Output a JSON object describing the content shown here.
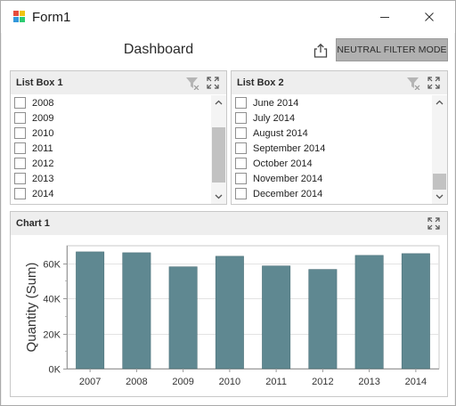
{
  "window": {
    "title": "Form1"
  },
  "dashboard": {
    "title": "Dashboard",
    "neutral_filter_label": "NEUTRAL FILTER MODE"
  },
  "list_box_1": {
    "title": "List Box 1",
    "items": [
      "2008",
      "2009",
      "2010",
      "2011",
      "2012",
      "2013",
      "2014"
    ]
  },
  "list_box_2": {
    "title": "List Box 2",
    "items": [
      "June 2014",
      "July 2014",
      "August 2014",
      "September 2014",
      "October 2014",
      "November 2014",
      "December 2014"
    ]
  },
  "chart_panel": {
    "title": "Chart 1"
  },
  "chart_data": {
    "type": "bar",
    "categories": [
      "2007",
      "2008",
      "2009",
      "2010",
      "2011",
      "2012",
      "2013",
      "2014"
    ],
    "values": [
      66500,
      66000,
      58000,
      64000,
      58500,
      56500,
      64500,
      65500
    ],
    "ylabel": "Quantity (Sum)",
    "ylim": [
      0,
      70000
    ],
    "yticks": [
      0,
      20000,
      40000,
      60000
    ],
    "ytick_labels": [
      "0K",
      "20K",
      "40K",
      "60K"
    ],
    "bar_color": "#5f8891",
    "grid": true
  },
  "colors": {
    "bar": "#5f8891",
    "neutral_button": "#b0b0b0",
    "caption_bg": "#eeeeee"
  }
}
